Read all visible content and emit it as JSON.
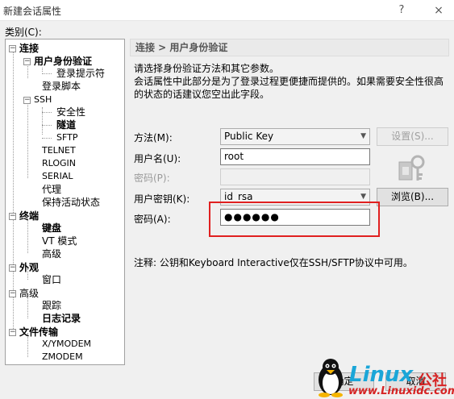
{
  "window": {
    "title": "新建会话属性",
    "help_icon": "?",
    "close_icon": "×"
  },
  "category_label": "类别(C):",
  "tree": {
    "items": [
      {
        "label": "连接",
        "bold": true
      },
      {
        "label": "用户身份验证",
        "bold": true
      },
      {
        "label": "登录提示符"
      },
      {
        "label": "登录脚本"
      },
      {
        "label": "SSH"
      },
      {
        "label": "安全性"
      },
      {
        "label": "隧道",
        "bold": true
      },
      {
        "label": "SFTP"
      },
      {
        "label": "TELNET"
      },
      {
        "label": "RLOGIN"
      },
      {
        "label": "SERIAL"
      },
      {
        "label": "代理"
      },
      {
        "label": "保持活动状态"
      },
      {
        "label": "终端",
        "bold": true
      },
      {
        "label": "键盘",
        "bold": true
      },
      {
        "label": "VT 模式"
      },
      {
        "label": "高级"
      },
      {
        "label": "外观",
        "bold": true
      },
      {
        "label": "窗口"
      },
      {
        "label": "高级"
      },
      {
        "label": "跟踪"
      },
      {
        "label": "日志记录",
        "bold": true
      },
      {
        "label": "文件传输",
        "bold": true
      },
      {
        "label": "X/YMODEM"
      },
      {
        "label": "ZMODEM"
      }
    ]
  },
  "panel": {
    "header": "连接 > 用户身份验证",
    "desc1": "请选择身份验证方法和其它参数。",
    "desc2": "会话属性中此部分是为了登录过程更便捷而提供的。如果需要安全性很高的状态的话建议您空出此字段。",
    "method_label": "方法(M):",
    "method_value": "Public Key",
    "settings_button": "设置(S)...",
    "username_label": "用户名(U):",
    "username_value": "root",
    "password_label": "密码(P):",
    "password_value": "",
    "userkey_label": "用户密钥(K):",
    "userkey_value": "id_rsa",
    "browse_button": "浏览(B)...",
    "passphrase_label": "密码(A):",
    "passphrase_value": "●●●●●●",
    "note": "注释: 公钥和Keyboard Interactive仅在SSH/SFTP协议中可用。"
  },
  "footer": {
    "ok_button": "确定",
    "cancel_button": "取消"
  },
  "watermark": {
    "brand": "Linux",
    "brand_cn": "公社",
    "url": "www.Linuxidc.com"
  },
  "colors": {
    "highlight": "#e02020",
    "watermark_blue": "#1aa6d8",
    "watermark_red": "#d62424"
  }
}
